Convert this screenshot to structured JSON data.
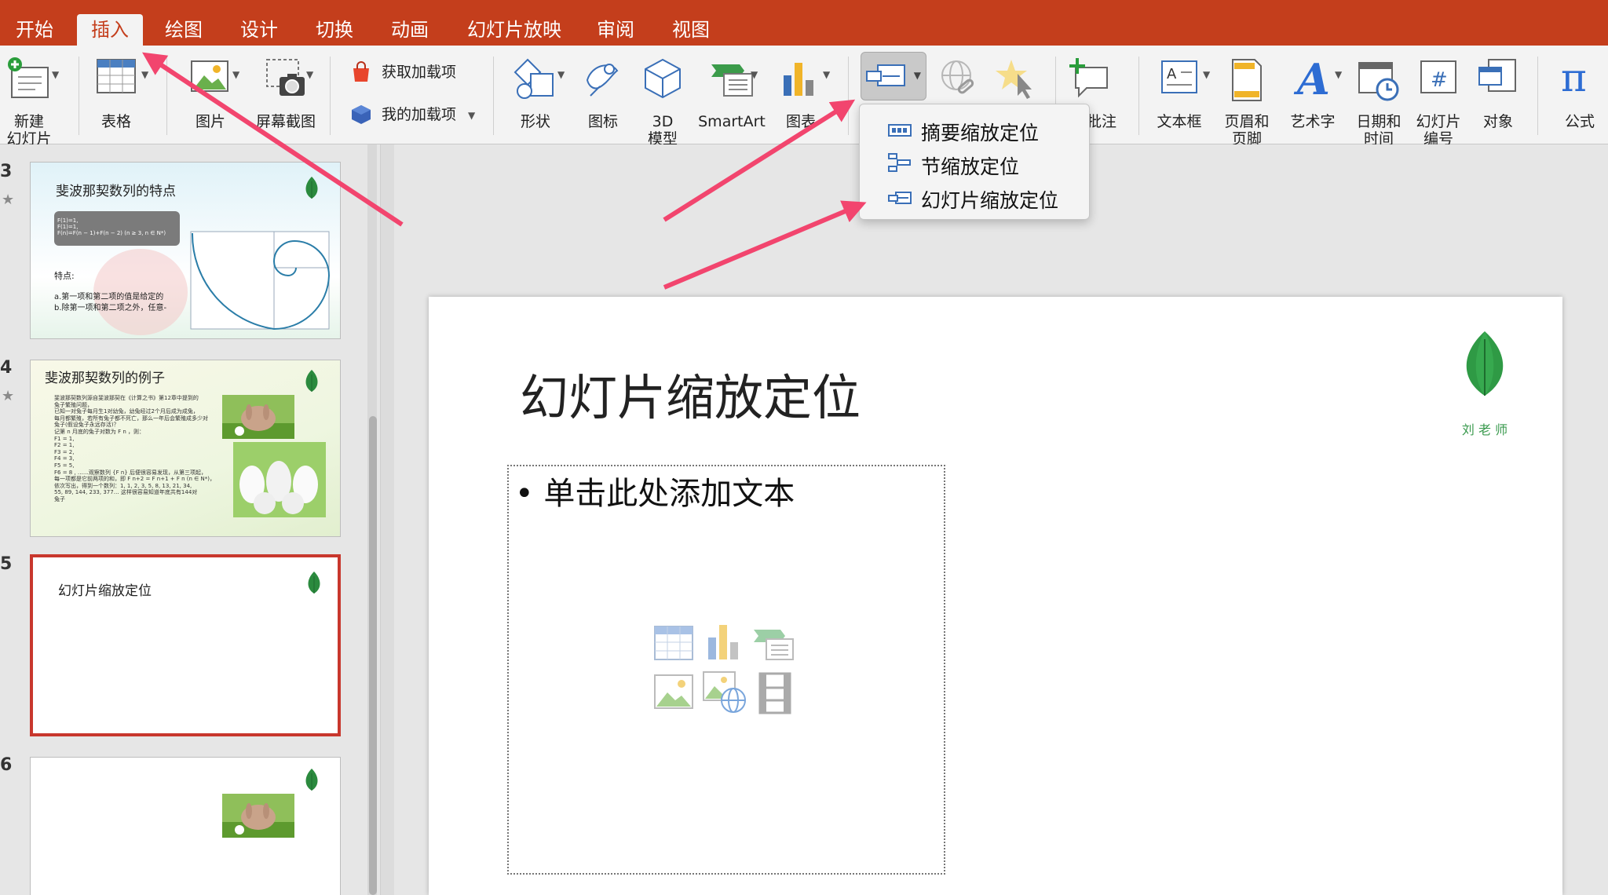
{
  "tabs": [
    {
      "label": "开始",
      "active": false
    },
    {
      "label": "插入",
      "active": true
    },
    {
      "label": "绘图",
      "active": false
    },
    {
      "label": "设计",
      "active": false
    },
    {
      "label": "切换",
      "active": false
    },
    {
      "label": "动画",
      "active": false
    },
    {
      "label": "幻灯片放映",
      "active": false
    },
    {
      "label": "审阅",
      "active": false
    },
    {
      "label": "视图",
      "active": false
    }
  ],
  "ribbon": {
    "new_slide": "新建\n幻灯片",
    "table": "表格",
    "picture": "图片",
    "screenshot": "屏幕截图",
    "get_addins": "获取加载项",
    "my_addins": "我的加载项",
    "shapes": "形状",
    "icons": "图标",
    "model3d": "3D\n模型",
    "smartart": "SmartArt",
    "chart": "图表",
    "comment": "批注",
    "textbox": "文本框",
    "header_footer": "页眉和\n页脚",
    "wordart": "艺术字",
    "datetime": "日期和\n时间",
    "slide_number": "幻灯片\n编号",
    "object": "对象",
    "equation": "公式"
  },
  "zoom_menu": {
    "items": [
      "摘要缩放定位",
      "节缩放定位",
      "幻灯片缩放定位"
    ]
  },
  "thumbnails": [
    {
      "number": "3",
      "title": "斐波那契数列的特点",
      "formula_lines": [
        "F(1)=1,",
        "F(1)=1,",
        "F(n)=F(n − 1)+F(n − 2) (n ≥ 3, n ∈ N*)"
      ],
      "body_lines": [
        "特点:",
        "a.第一项和第二项的值是给定的",
        "b.除第一项和第二项之外，任意-"
      ]
    },
    {
      "number": "4",
      "title": "斐波那契数列的例子",
      "body_lines": [
        "斐波那契数列源自斐波那契在《计算之书》第12章中提到的",
        "兔子繁殖问题，",
        "已知一对兔子每月生1对幼兔，幼兔经过2个月后成为成兔，",
        "每月都繁殖，若所有兔子都不死亡，那么一年后会繁殖成多少对",
        "兔子(假设兔子永远存活)？",
        "记第 n 月底的兔子对数为 F n ，则：",
        "F1 = 1,",
        "F2 = 1,",
        "F3 = 2,",
        "F4 = 3,",
        "F5 = 5,",
        "F6 = 8 , ……观察数列 {F n} 后便很容易发现，从第三项起，",
        "每一项都是它前两项的和，即 F n+2 = F n+1 + F n (n ∈ N*)，",
        "依次写出，得到一个数列：1, 1, 2, 3, 5, 8, 13, 21, 34,",
        "55, 89, 144, 233, 377… 这样很容易知道年底共有144对",
        "兔子"
      ]
    },
    {
      "number": "5",
      "title": "幻灯片缩放定位",
      "selected": true
    },
    {
      "number": "6",
      "title": ""
    }
  ],
  "slide": {
    "title": "幻灯片缩放定位",
    "bullet": "单击此处添加文本",
    "logo_caption": "刘 老 师"
  },
  "colors": {
    "accent": "#c43e1c",
    "arrow": "#f2456e",
    "selection": "#c8372d"
  }
}
